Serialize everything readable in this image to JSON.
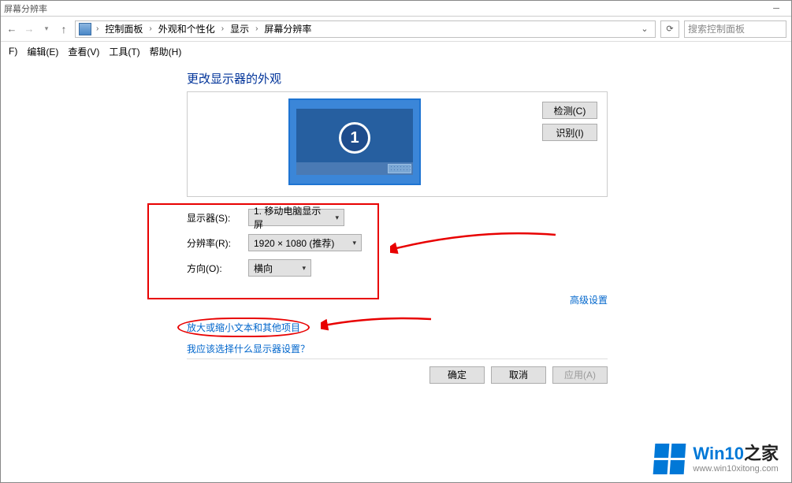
{
  "titlebar": {
    "title": "屏幕分辨率"
  },
  "address": {
    "crumbs": [
      "控制面板",
      "外观和个性化",
      "显示",
      "屏幕分辨率"
    ]
  },
  "search": {
    "placeholder": "搜索控制面板"
  },
  "menu": {
    "file": "F)",
    "edit": "编辑(E)",
    "view": "查看(V)",
    "tools": "工具(T)",
    "help": "帮助(H)"
  },
  "heading": "更改显示器的外观",
  "monitor": {
    "number": "1"
  },
  "panel_buttons": {
    "detect": "检测(C)",
    "identify": "识别(I)"
  },
  "form": {
    "display_label": "显示器(S):",
    "display_value": "1. 移动电脑显示屏",
    "resolution_label": "分辨率(R):",
    "resolution_value": "1920 × 1080 (推荐)",
    "orientation_label": "方向(O):",
    "orientation_value": "横向"
  },
  "links": {
    "advanced": "高级设置",
    "zoom": "放大或缩小文本和其他项目",
    "which": "我应该选择什么显示器设置？"
  },
  "actions": {
    "ok": "确定",
    "cancel": "取消",
    "apply": "应用(A)"
  },
  "watermark": {
    "brand_a": "Win10",
    "brand_b": "之家",
    "url": "www.win10xitong.com"
  }
}
